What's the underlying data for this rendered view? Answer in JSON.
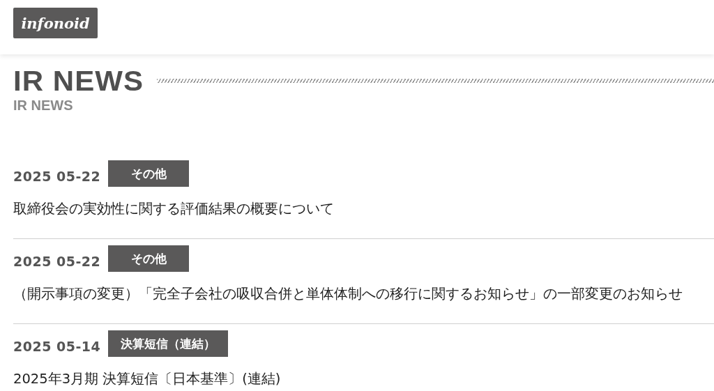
{
  "header": {
    "logo": "infonoid"
  },
  "heading": {
    "title": "IR NEWS",
    "subtitle": "IR NEWS"
  },
  "news": [
    {
      "date": "2025 05-22",
      "category": "その他",
      "title": "取締役会の実効性に関する評価結果の概要について"
    },
    {
      "date": "2025 05-22",
      "category": "その他",
      "title": "（開示事項の変更）「完全子会社の吸収合併と単体体制への移行に関するお知らせ」の一部変更のお知らせ"
    },
    {
      "date": "2025 05-14",
      "category": "決算短信（連結）",
      "title": "2025年3月期 決算短信〔日本基準〕(連結)"
    }
  ]
}
